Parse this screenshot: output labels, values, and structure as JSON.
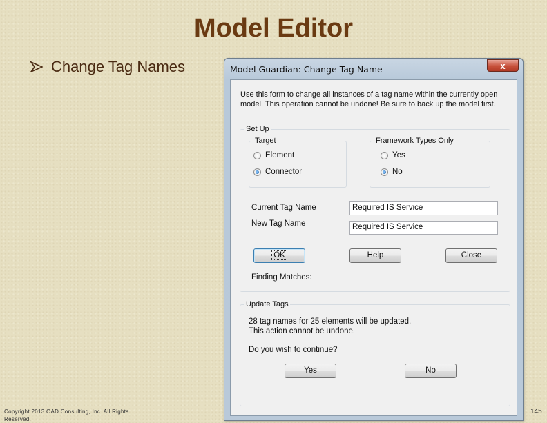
{
  "slide": {
    "title": "Model Editor",
    "bullet": "Change Tag Names",
    "copyright": "Copyright 2013 OAD Consulting, Inc. All Rights Reserved.",
    "page_number": "145"
  },
  "dialog": {
    "title": "Model Guardian: Change Tag Name",
    "close_symbol": "x",
    "instructions": "Use this form to change all instances of a tag name within the currently open model. This operation cannot be undone! Be sure to back up the model first.",
    "setup": {
      "label": "Set Up",
      "target": {
        "label": "Target",
        "options": [
          "Element",
          "Connector"
        ],
        "selected": "Connector"
      },
      "framework": {
        "label": "Framework Types Only",
        "options": [
          "Yes",
          "No"
        ],
        "selected": "No"
      },
      "current_tag_label": "Current Tag Name",
      "current_tag_value": "Required IS Service",
      "new_tag_label": "New Tag Name",
      "new_tag_value": "Required IS Service",
      "buttons": {
        "ok": "OK",
        "help": "Help",
        "close": "Close"
      },
      "finding_matches": "Finding Matches:"
    },
    "update": {
      "label": "Update Tags",
      "line1": "28 tag names for 25 elements will be updated.",
      "line2": "This action cannot be undone.",
      "question": "Do you wish to continue?",
      "yes": "Yes",
      "no": "No"
    }
  },
  "colors": {
    "title": "#6a3a12",
    "background": "#e6dfc1",
    "close_button": "#c7513b"
  }
}
